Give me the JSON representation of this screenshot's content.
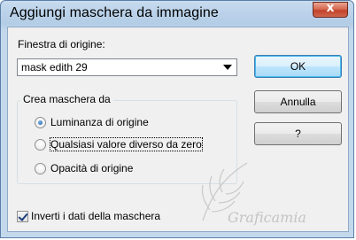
{
  "window": {
    "title": "Aggiungi maschera da immagine",
    "close_glyph": "x"
  },
  "source": {
    "label": "Finestra di origine:",
    "selected": "mask edith 29"
  },
  "group": {
    "title": "Crea maschera da",
    "options": [
      {
        "label": "Luminanza di origine",
        "checked": true
      },
      {
        "label": "Qualsiasi valore diverso da zero",
        "checked": false
      },
      {
        "label": "Opacità di origine",
        "checked": false
      }
    ]
  },
  "buttons": {
    "ok": "OK",
    "cancel": "Annulla",
    "help": "?"
  },
  "invert": {
    "label": "Inverti i dati della maschera",
    "checked": true
  },
  "watermark": {
    "text": "Graficamia"
  }
}
